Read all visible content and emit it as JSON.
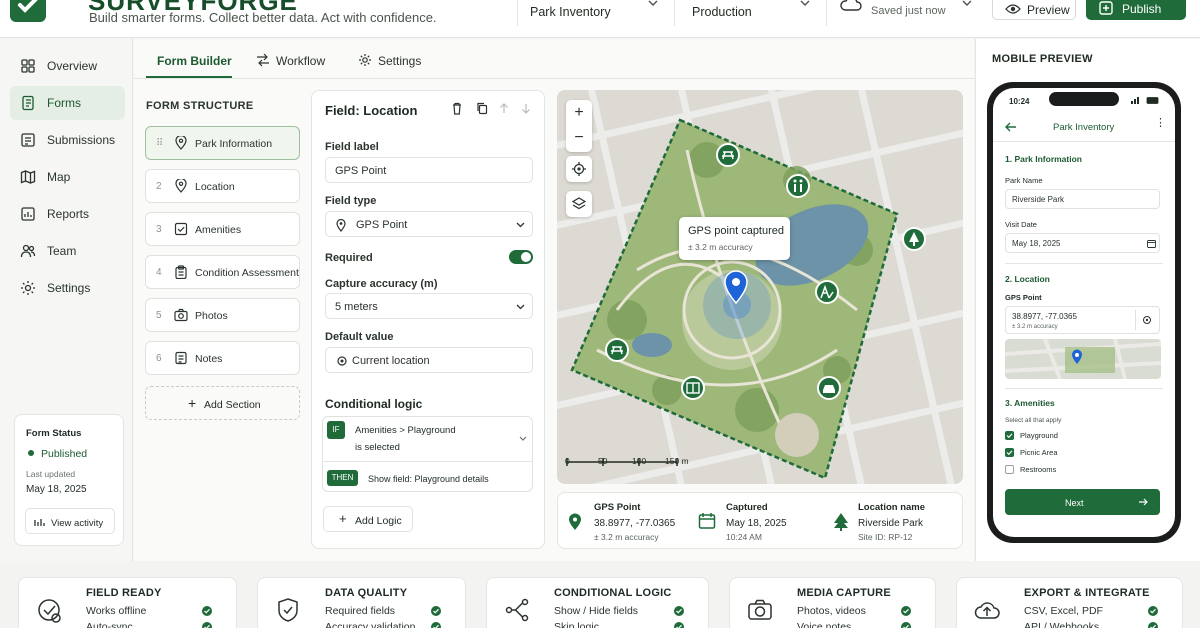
{
  "app": {
    "brand": "SURVEYFORGE",
    "tagline": "Build smarter forms. Collect better data. Act with confidence.",
    "project": "Park Inventory",
    "environment": "Production",
    "save_status": "Saved just now",
    "preview_label": "Preview",
    "publish_label": "Publish"
  },
  "sidebar": {
    "items": [
      {
        "label": "Overview",
        "icon": "overview-icon"
      },
      {
        "label": "Forms",
        "icon": "forms-icon",
        "active": true
      },
      {
        "label": "Submissions",
        "icon": "submissions-icon"
      },
      {
        "label": "Map",
        "icon": "map-icon"
      },
      {
        "label": "Reports",
        "icon": "reports-icon"
      },
      {
        "label": "Team",
        "icon": "team-icon"
      },
      {
        "label": "Settings",
        "icon": "settings-icon"
      }
    ],
    "status": {
      "title": "Form Status",
      "state": "Published",
      "updated_label": "Last updated",
      "updated_date": "May 18, 2025",
      "activity_label": "View activity"
    }
  },
  "tabs": [
    {
      "label": "Form Builder",
      "active": true
    },
    {
      "label": "Workflow"
    },
    {
      "label": "Settings"
    }
  ],
  "structure": {
    "title": "FORM STRUCTURE",
    "items": [
      {
        "num": "",
        "label": "Park Information"
      },
      {
        "num": "2",
        "label": "Location"
      },
      {
        "num": "3",
        "label": "Amenities"
      },
      {
        "num": "4",
        "label": "Condition Assessment"
      },
      {
        "num": "5",
        "label": "Photos"
      },
      {
        "num": "6",
        "label": "Notes"
      }
    ],
    "add_section": "Add Section"
  },
  "field": {
    "title": "Field: Location",
    "label_label": "Field label",
    "label_value": "GPS Point",
    "type_label": "Field type",
    "type_value": "GPS Point",
    "required_label": "Required",
    "accuracy_label": "Capture accuracy (m)",
    "accuracy_value": "5 meters",
    "default_label": "Default value",
    "default_value": "Current location",
    "logic_title": "Conditional logic",
    "if_tag": "IF",
    "if_line1": "Amenities > Playground",
    "if_line2": "is selected",
    "then_tag": "THEN",
    "then_text": "Show field:  Playground details",
    "add_logic": "Add Logic"
  },
  "map": {
    "popup_title": "GPS point captured",
    "popup_sub": "± 3.2 m accuracy",
    "scale": [
      "0",
      "50",
      "100",
      "150 m"
    ],
    "info": {
      "gps_title": "GPS Point",
      "gps_coords": "38.8977, -77.0365",
      "gps_acc": "± 3.2 m accuracy",
      "cap_title": "Captured",
      "cap_date": "May 18, 2025",
      "cap_time": "10:24 AM",
      "loc_title": "Location name",
      "loc_name": "Riverside Park",
      "loc_site": "Site ID: RP-12"
    }
  },
  "mobile": {
    "header": "MOBILE PREVIEW",
    "time": "10:24",
    "title": "Park Inventory",
    "s1": "1. Park Information",
    "park_name_label": "Park Name",
    "park_name_value": "Riverside Park",
    "visit_label": "Visit Date",
    "visit_value": "May 18, 2025",
    "s2": "2. Location",
    "gps_label": "GPS Point",
    "gps_coords": "38.8977, -77.0365",
    "gps_acc": "± 3.2 m accuracy",
    "s3": "3. Amenities",
    "select_hint": "Select all that apply",
    "options": [
      {
        "label": "Playground",
        "checked": true
      },
      {
        "label": "Picnic Area",
        "checked": true
      },
      {
        "label": "Restrooms",
        "checked": false
      }
    ],
    "next_label": "Next"
  },
  "features": [
    {
      "title": "FIELD READY",
      "items": [
        "Works offline",
        "Auto-sync"
      ]
    },
    {
      "title": "DATA QUALITY",
      "items": [
        "Required fields",
        "Accuracy validation"
      ]
    },
    {
      "title": "CONDITIONAL LOGIC",
      "items": [
        "Show / Hide fields",
        "Skip logic"
      ]
    },
    {
      "title": "MEDIA CAPTURE",
      "items": [
        "Photos, videos",
        "Voice notes"
      ]
    },
    {
      "title": "EXPORT & INTEGRATE",
      "items": [
        "CSV, Excel, PDF",
        "API / Webhooks"
      ]
    }
  ],
  "colors": {
    "accent": "#1f6b3a",
    "accent_light": "#e5eee4",
    "map_park": "#9db878"
  }
}
